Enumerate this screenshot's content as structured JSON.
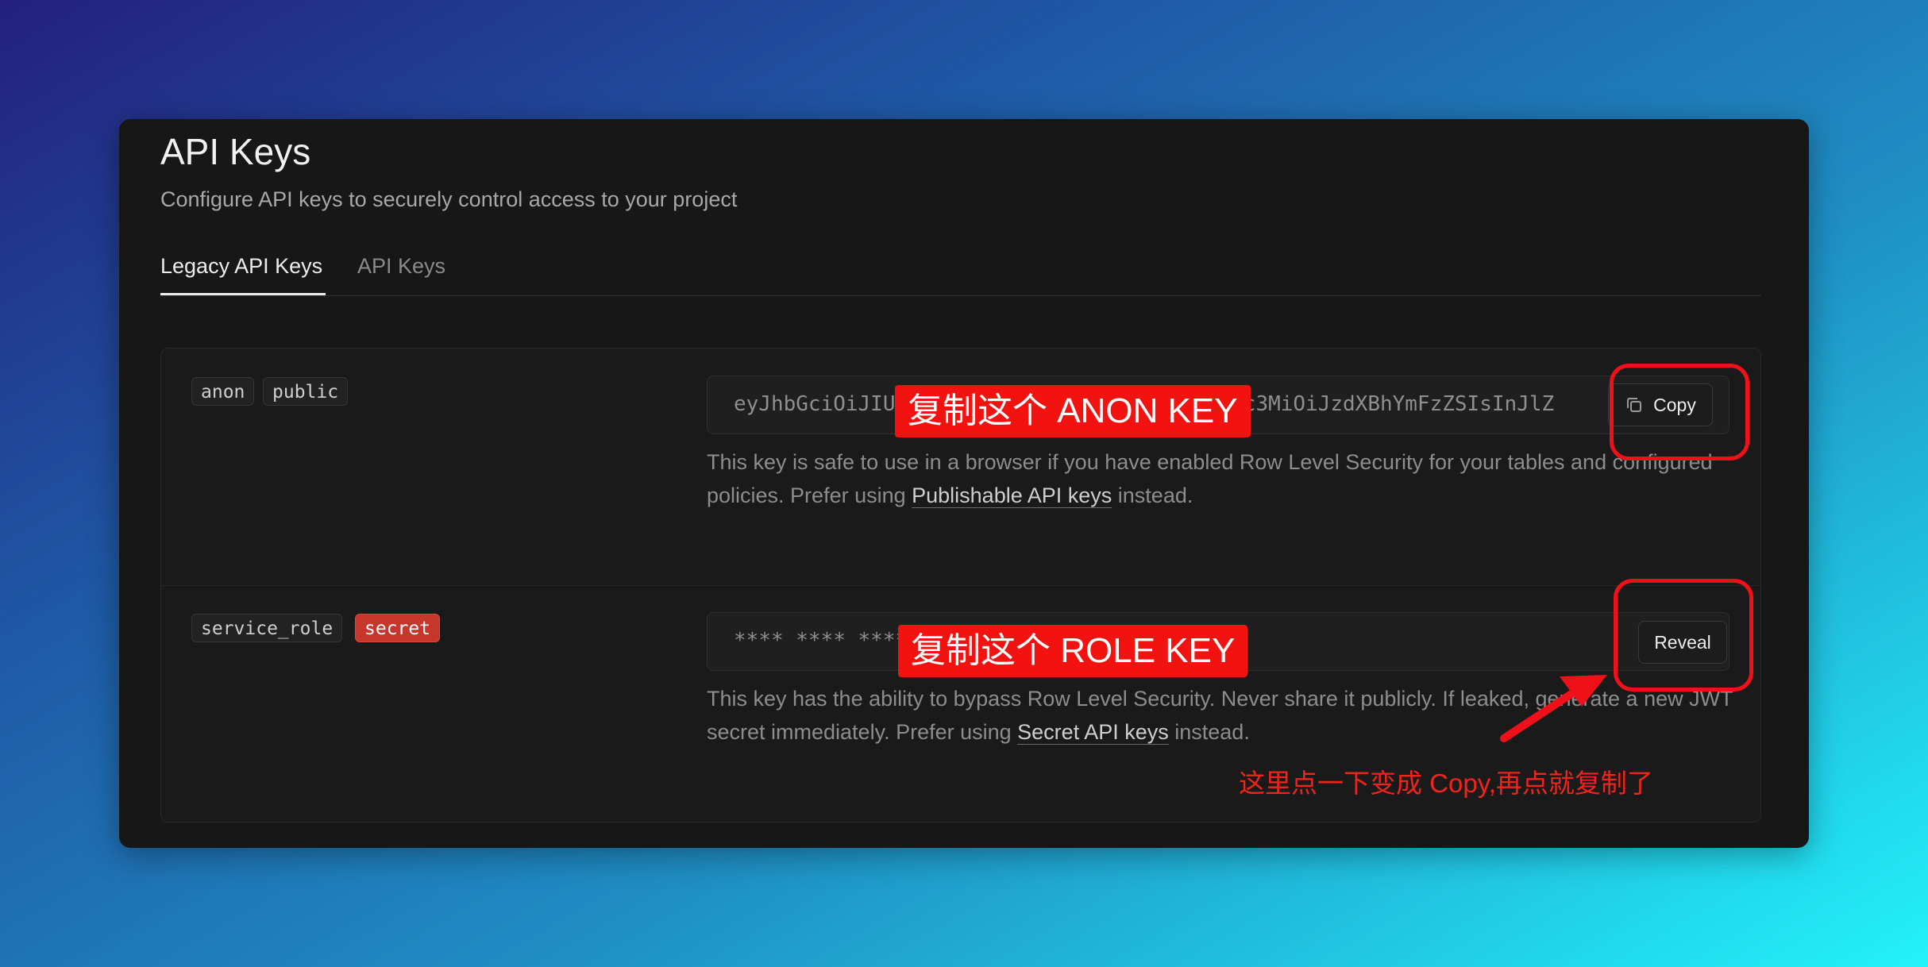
{
  "header": {
    "title": "API Keys",
    "subtitle": "Configure API keys to securely control access to your project"
  },
  "tabs": [
    {
      "label": "Legacy API Keys",
      "active": true
    },
    {
      "label": "API Keys",
      "active": false
    }
  ],
  "keys": {
    "anon": {
      "tags": [
        "anon",
        "public"
      ],
      "value": "eyJhbGciOiJIUzI1NiIsInR5cCI6IkpXVCJ9.eyJpc3MiOiJzdXBhYmFzZSIsInJlZ",
      "button": "Copy",
      "desc_before": "This key is safe to use in a browser if you have enabled Row Level Security for your tables and configured policies. Prefer using ",
      "desc_link": "Publishable API keys",
      "desc_after": " instead."
    },
    "service": {
      "tags": [
        "service_role",
        "secret"
      ],
      "value": "**** **** **** ****",
      "button": "Reveal",
      "desc_before": "This key has the ability to bypass Row Level Security. Never share it publicly. If leaked, generate a new JWT secret immediately. Prefer using ",
      "desc_link": "Secret API keys",
      "desc_after": " instead."
    }
  },
  "annotations": {
    "anon_label": "复制这个 ANON KEY",
    "role_label": "复制这个 ROLE KEY",
    "note": "这里点一下变成 Copy,再点就复制了"
  },
  "colors": {
    "accent_red": "#f2120f",
    "secret_tag": "#c7362b"
  },
  "icons": {
    "copy": "copy-icon"
  }
}
